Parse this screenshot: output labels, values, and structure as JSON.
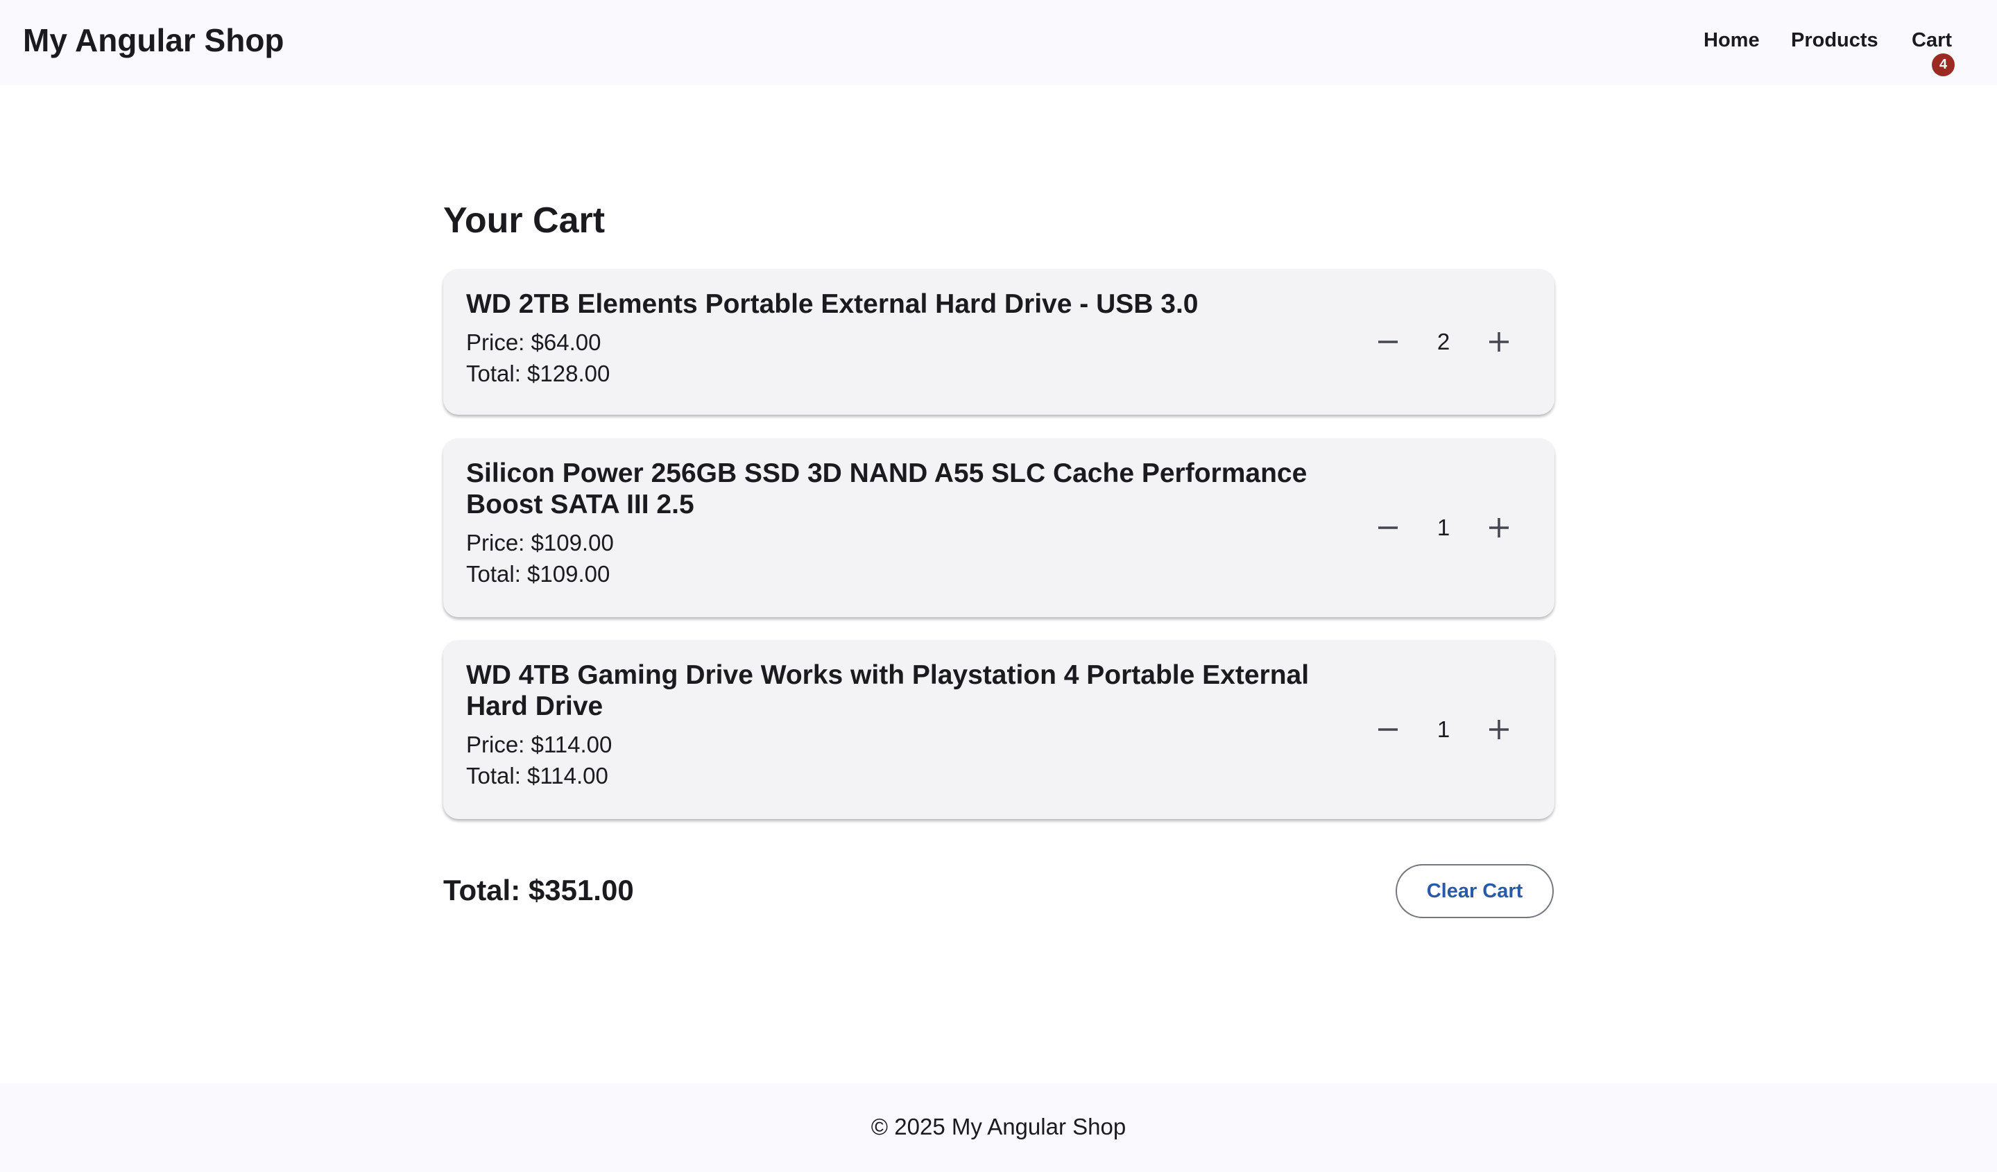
{
  "header": {
    "brand": "My Angular Shop",
    "nav": {
      "home": "Home",
      "products": "Products",
      "cart": "Cart",
      "cart_count": "4"
    }
  },
  "main": {
    "title": "Your Cart",
    "items": [
      {
        "name": "WD 2TB Elements Portable External Hard Drive - USB 3.0",
        "price": "Price: $64.00",
        "total": "Total: $128.00",
        "quantity": "2"
      },
      {
        "name": "Silicon Power 256GB SSD 3D NAND A55 SLC Cache Performance Boost SATA III 2.5",
        "price": "Price: $109.00",
        "total": "Total: $109.00",
        "quantity": "1"
      },
      {
        "name": "WD 4TB Gaming Drive Works with Playstation 4 Portable External Hard Drive",
        "price": "Price: $114.00",
        "total": "Total: $114.00",
        "quantity": "1"
      }
    ],
    "grand_total": "Total: $351.00",
    "clear_label": "Clear Cart"
  },
  "footer": {
    "text": "© 2025 My Angular Shop"
  },
  "icons": {
    "decrement": "minus-icon",
    "increment": "plus-icon"
  },
  "colors": {
    "badge": "#9a2a22",
    "accent": "#2a5aa5",
    "card": "#f3f3f5",
    "toolbar": "#faf9fd"
  }
}
